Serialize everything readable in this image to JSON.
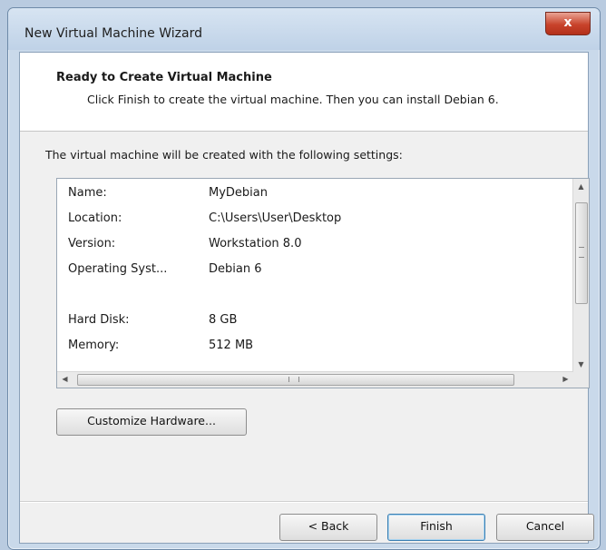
{
  "window": {
    "title": "New Virtual Machine Wizard",
    "close_glyph": "x"
  },
  "header": {
    "title": "Ready to Create Virtual Machine",
    "subtitle": "Click Finish to create the virtual machine. Then you can install Debian 6."
  },
  "intro_text": "The virtual machine will be created with the following settings:",
  "settings": [
    {
      "key": "Name:",
      "value": "MyDebian"
    },
    {
      "key": "Location:",
      "value": "C:\\Users\\User\\Desktop"
    },
    {
      "key": "Version:",
      "value": "Workstation 8.0"
    },
    {
      "key": "Operating Syst...",
      "value": "Debian 6"
    },
    {
      "key": "Hard Disk:",
      "value": "8 GB"
    },
    {
      "key": "Memory:",
      "value": "512 MB"
    }
  ],
  "buttons": {
    "customize": "Customize Hardware...",
    "back": "< Back",
    "finish": "Finish",
    "cancel": "Cancel"
  },
  "icons": {
    "scroll_up": "scroll-up-arrow-icon",
    "scroll_down": "scroll-down-arrow-icon",
    "scroll_left": "scroll-left-arrow-icon",
    "scroll_right": "scroll-right-arrow-icon"
  }
}
